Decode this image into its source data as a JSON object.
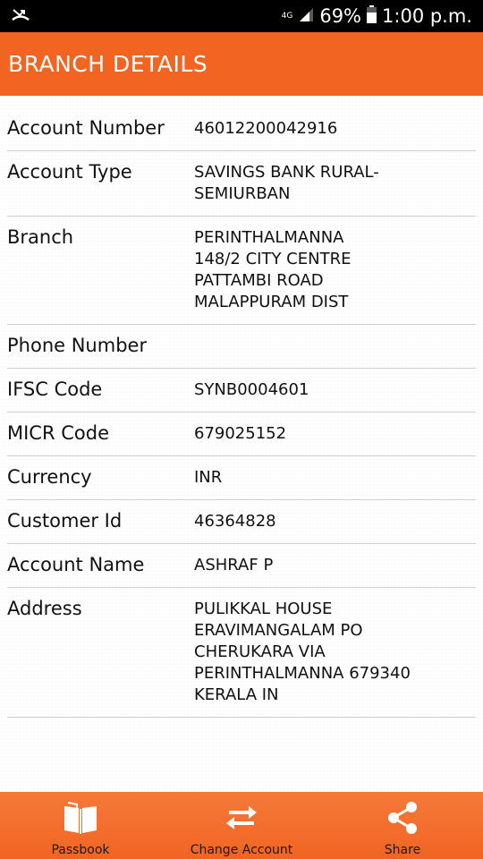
{
  "status_bar": {
    "network_type": "4G",
    "battery": "69%",
    "time": "1:00 p.m."
  },
  "header": {
    "title": "BRANCH DETAILS"
  },
  "details": [
    {
      "label": "Account Number",
      "value": "46012200042916"
    },
    {
      "label": "Account Type",
      "value": "SAVINGS BANK RURAL-\nSEMIURBAN"
    },
    {
      "label": "Branch",
      "value": "PERINTHALMANNA\n148/2 CITY CENTRE\nPATTAMBI ROAD\nMALAPPURAM DIST\n "
    },
    {
      "label": "Phone Number",
      "value": ""
    },
    {
      "label": "IFSC Code",
      "value": "SYNB0004601"
    },
    {
      "label": "MICR Code",
      "value": "679025152"
    },
    {
      "label": "Currency",
      "value": "INR"
    },
    {
      "label": "Customer Id",
      "value": "46364828"
    },
    {
      "label": "Account Name",
      "value": "ASHRAF P"
    },
    {
      "label": "Address",
      "value": "PULIKKAL HOUSE\nERAVIMANGALAM PO\nCHERUKARA VIA\nPERINTHALMANNA 679340\nKERALA IN"
    }
  ],
  "bottom_nav": {
    "passbook_label": "Passbook",
    "change_account_label": "Change Account",
    "share_label": "Share",
    "icons": {
      "passbook": "book-icon",
      "change_account": "swap-arrows-icon",
      "share": "share-icon"
    }
  },
  "colors": {
    "accent": "#f26422",
    "status_bar": "#000000",
    "divider": "#cfcfcf"
  }
}
